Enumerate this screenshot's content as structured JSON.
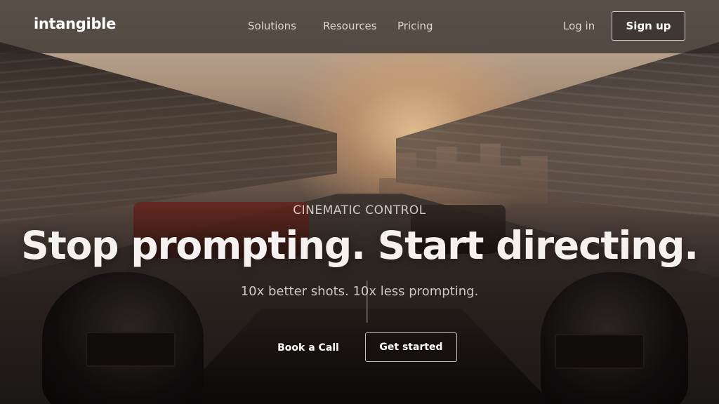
{
  "navbar": {
    "logo": "intangible",
    "links": [
      "Solutions",
      "Resources",
      "Pricing"
    ],
    "login_label": "Log in",
    "signup_label": "Sign up"
  },
  "hero": {
    "eyebrow": "CINEMATIC CONTROL",
    "headline": "Stop prompting. Start directing.",
    "subhead": "10x better shots. 10x less prompting.",
    "primary_cta": "Book a Call",
    "secondary_cta": "Get started",
    "background": "race-track-cockpit-view"
  },
  "colors": {
    "text": "#ffffff",
    "nav_text": "#d9d4d0",
    "navbar_bg": "#2d2826"
  }
}
